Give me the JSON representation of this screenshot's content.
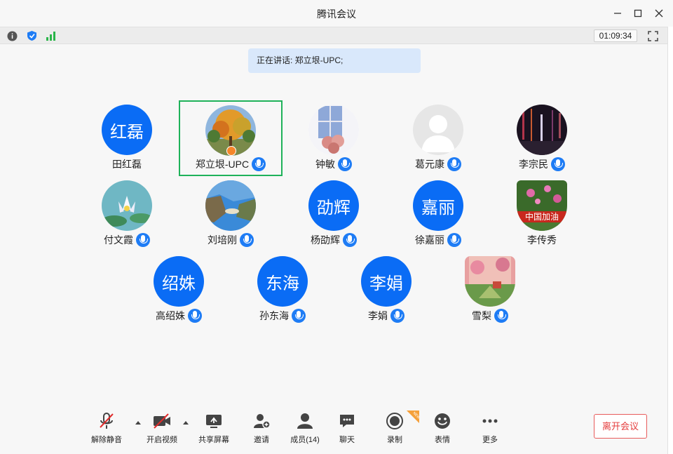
{
  "window": {
    "title": "腾讯会议"
  },
  "status": {
    "timer": "01:09:34"
  },
  "speaking": {
    "text": "正在讲话: 郑立垠-UPC;"
  },
  "participants": [
    {
      "name": "田红磊",
      "avatar_text": "红磊",
      "mic": false
    },
    {
      "name": "郑立垠-UPC",
      "avatar_text": "",
      "mic": true,
      "host": true,
      "active": true
    },
    {
      "name": "钟敏",
      "avatar_text": "",
      "mic": true
    },
    {
      "name": "葛元康",
      "avatar_text": "",
      "mic": true
    },
    {
      "name": "李宗民",
      "avatar_text": "",
      "mic": true
    },
    {
      "name": "付文霞",
      "avatar_text": "",
      "mic": true
    },
    {
      "name": "刘培刚",
      "avatar_text": "",
      "mic": true
    },
    {
      "name": "杨劭辉",
      "avatar_text": "劭辉",
      "mic": true
    },
    {
      "name": "徐嘉丽",
      "avatar_text": "嘉丽",
      "mic": true
    },
    {
      "name": "李传秀",
      "avatar_text": "",
      "mic": false
    },
    {
      "name": "高绍姝",
      "avatar_text": "绍姝",
      "mic": true
    },
    {
      "name": "孙东海",
      "avatar_text": "东海",
      "mic": true
    },
    {
      "name": "李娟",
      "avatar_text": "李娟",
      "mic": true
    },
    {
      "name": "雪梨",
      "avatar_text": "",
      "mic": true
    }
  ],
  "avatar_photo_text": {
    "china_banner": "中国加油"
  },
  "toolbar": {
    "unmute": "解除静音",
    "start_video": "开启视频",
    "share_screen": "共享屏幕",
    "invite": "邀请",
    "members": "成员(14)",
    "chat": "聊天",
    "record": "录制",
    "reactions": "表情",
    "more": "更多",
    "leave": "离开会议",
    "new_tag": "NEW"
  },
  "colors": {
    "accent": "#0a6cf5",
    "active_border": "#1fb25a",
    "leave": "#e43c3c",
    "host_badge": "#f5862a"
  }
}
